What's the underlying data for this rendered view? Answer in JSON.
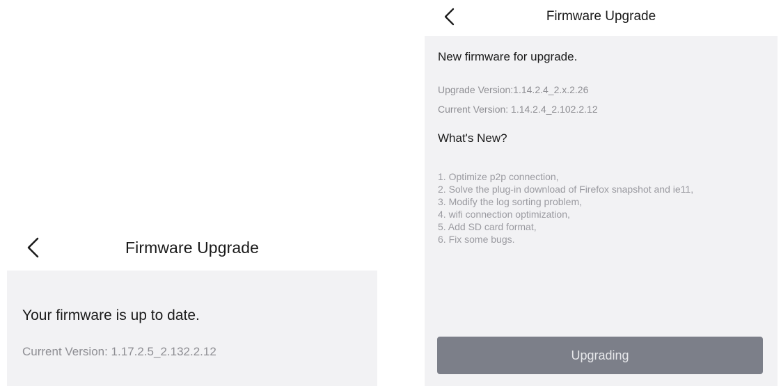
{
  "left_screen": {
    "navbar": {
      "back_icon": "chevron-left-icon",
      "title": "Firmware Upgrade"
    },
    "status_text": "Your firmware is up to date.",
    "current_version": "Current Version: 1.17.2.5_2.132.2.12"
  },
  "right_screen": {
    "navbar": {
      "back_icon": "chevron-left-icon",
      "title": "Firmware Upgrade"
    },
    "headline": "New firmware for upgrade.",
    "upgrade_version": "Upgrade Version:1.14.2.4_2.x.2.26",
    "current_version": "Current Version: 1.14.2.4_2.102.2.12",
    "whats_new_heading": "What's New?",
    "release_notes": [
      "1. Optimize p2p connection,",
      "2. Solve the plug-in download of Firefox snapshot and ie11,",
      "3. Modify the log sorting problem,",
      "4. wifi connection optimization,",
      "5. Add SD card format,",
      "6. Fix some bugs."
    ],
    "button_label": "Upgrading"
  },
  "colors": {
    "screen_background": "#f2f2f4",
    "navbar_background": "#ffffff",
    "primary_text": "#1a1a1a",
    "secondary_text": "#8e8e93",
    "button_background": "#7c7f89",
    "button_text": "#e6e7ea"
  }
}
